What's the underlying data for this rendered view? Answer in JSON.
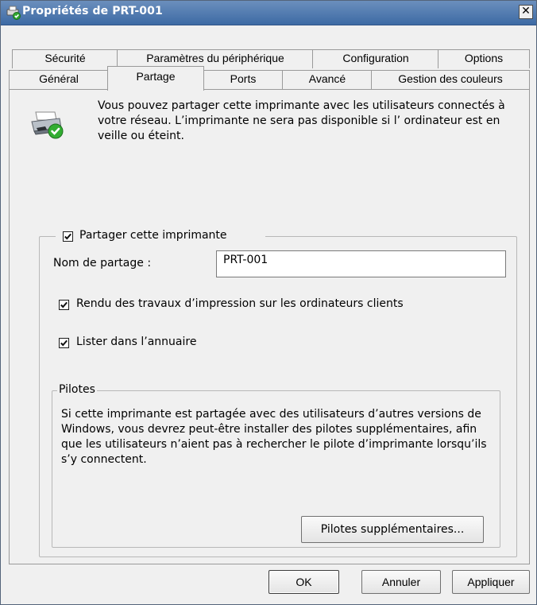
{
  "window": {
    "title": "Propriétés de PRT-001",
    "close_glyph": "✕"
  },
  "tabs": {
    "row_back": [
      "Sécurité",
      "Paramètres du périphérique",
      "Configuration",
      "Options"
    ],
    "row_front": [
      "Général",
      "Partage",
      "Ports",
      "Avancé",
      "Gestion des couleurs"
    ],
    "active": "Partage"
  },
  "intro_text": "Vous pouvez partager cette imprimante avec les utilisateurs connectés à votre réseau. L’imprimante ne sera pas disponible si l’ ordinateur est en veille ou éteint.",
  "share": {
    "checkbox_label": "Partager cette imprimante",
    "checked": true,
    "name_label": "Nom de partage :",
    "name_value": "PRT-001",
    "render_label": "Rendu des travaux d’impression sur les ordinateurs clients",
    "render_checked": true,
    "directory_label": "Lister dans l’annuaire",
    "directory_checked": true
  },
  "drivers": {
    "legend": "Pilotes",
    "text": "Si cette imprimante est partagée avec des utilisateurs d’autres versions de Windows, vous devrez peut-être installer des pilotes supplémentaires, afin que les utilisateurs n’aient pas à rechercher le pilote d’imprimante lorsqu’ils s’y connectent.",
    "button": "Pilotes supplémentaires..."
  },
  "footer": {
    "ok": "OK",
    "cancel": "Annuler",
    "apply": "Appliquer"
  },
  "icons": {
    "title_icon": "printer-shared-icon",
    "page_icon": "printer-shared-icon",
    "check_color": "#2fa82f",
    "titlebar_color": "#4a74aa"
  }
}
